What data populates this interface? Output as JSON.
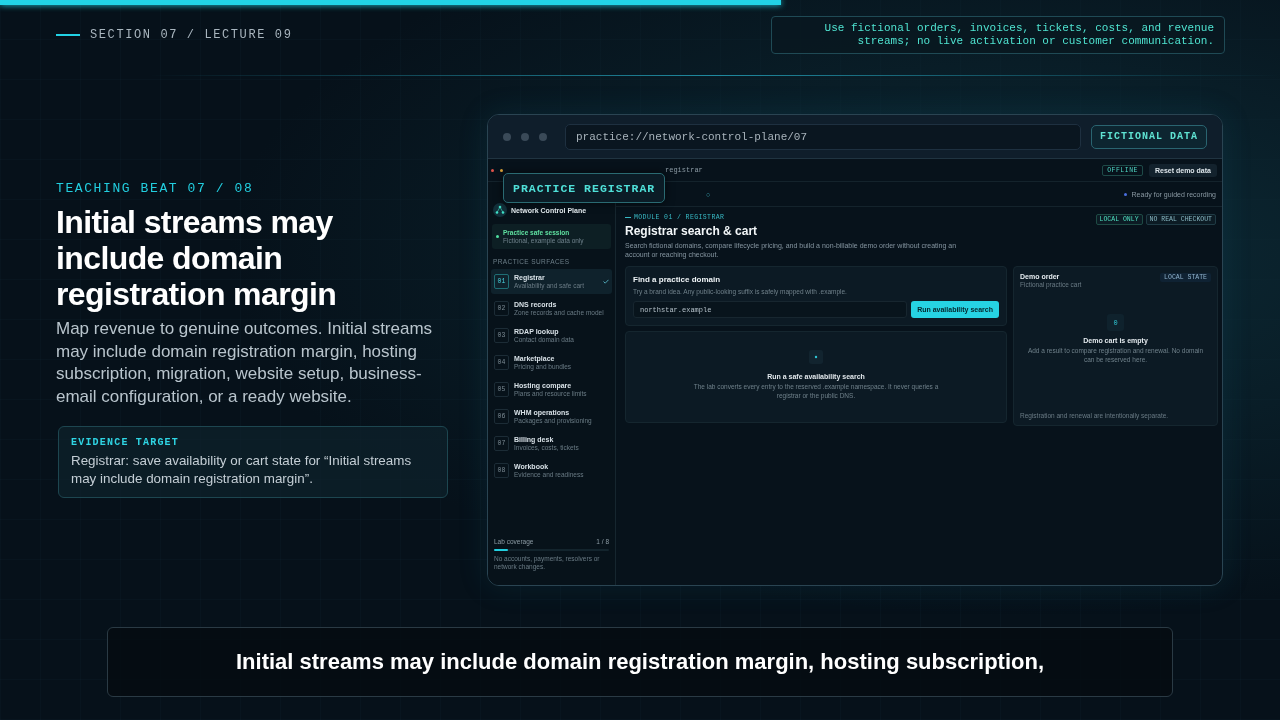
{
  "progress": {
    "level": 0.61
  },
  "header": {
    "section": "SECTION 07 / LECTURE 09",
    "notice": "Use fictional orders, invoices, tickets, costs, and revenue streams; no live activation or customer communication."
  },
  "lesson": {
    "beat": "TEACHING BEAT 07 / 08",
    "title": "Initial streams may include domain registration margin",
    "body": "Map revenue to genuine outcomes. Initial streams may include domain registration margin, hosting subscription, migration, website setup, business-email configuration, or a ready website.",
    "evidence": {
      "label": "EVIDENCE TARGET",
      "text": "Registrar: save availability or cart state for “Initial streams may include domain registration margin”."
    }
  },
  "browser": {
    "address": "practice://network-control-plane/07",
    "badge": "FICTIONAL DATA",
    "overlay_badge": "PRACTICE REGISTRAR"
  },
  "app": {
    "tab": "registrar",
    "status": "OFFLINE",
    "reset_button": "Reset demo data",
    "step_marker": "○",
    "ready": "Ready for guided recording",
    "brand": "Network Control Plane",
    "session": {
      "title": "Practice safe session",
      "subtitle": "Fictional, example data only"
    },
    "section_label": "PRACTICE SURFACES",
    "nav": [
      {
        "number": "01",
        "name": "Registrar",
        "sub": "Availability and safe cart",
        "selected": true
      },
      {
        "number": "02",
        "name": "DNS records",
        "sub": "Zone records and cache model",
        "selected": false
      },
      {
        "number": "03",
        "name": "RDAP lookup",
        "sub": "Contact domain data",
        "selected": false
      },
      {
        "number": "04",
        "name": "Marketplace",
        "sub": "Pricing and bundles",
        "selected": false
      },
      {
        "number": "05",
        "name": "Hosting compare",
        "sub": "Plans and resource limits",
        "selected": false
      },
      {
        "number": "06",
        "name": "WHM operations",
        "sub": "Packages and provisioning",
        "selected": false
      },
      {
        "number": "07",
        "name": "Billing desk",
        "sub": "Invoices, costs, tickets",
        "selected": false
      },
      {
        "number": "08",
        "name": "Workbook",
        "sub": "Evidence and readiness",
        "selected": false
      }
    ],
    "coverage": {
      "label": "Lab coverage",
      "reading": "1 / 8",
      "level": 0.125,
      "note": "No accounts, payments, resolvers or network changes."
    },
    "breadcrumb": "MODULE 01 / REGISTRAR",
    "title": "Registrar search & cart",
    "description": "Search fictional domains, compare lifecycle pricing, and build a non-billable demo order without creating an account or reaching checkout.",
    "chips": [
      "LOCAL ONLY",
      "NO REAL CHECKOUT"
    ],
    "search": {
      "title": "Find a practice domain",
      "hint": "Try a brand idea. Any public-looking suffix is safely mapped with .example.",
      "value": "northstar.example",
      "button": "Run availability search"
    },
    "empty_results": {
      "title": "Run a safe availability search",
      "text": "The lab converts every entry to the reserved .example namespace. It never queries a registrar or the public DNS."
    },
    "order": {
      "title": "Demo order",
      "subtitle": "Fictional practice cart",
      "badge": "LOCAL STATE",
      "count": "0",
      "empty_title": "Demo cart is empty",
      "empty_text": "Add a result to compare registration and renewal. No domain can be reserved here.",
      "footer": "Registration and renewal are intentionally separate."
    }
  },
  "caption": "Initial streams may include domain registration margin, hosting subscription,"
}
